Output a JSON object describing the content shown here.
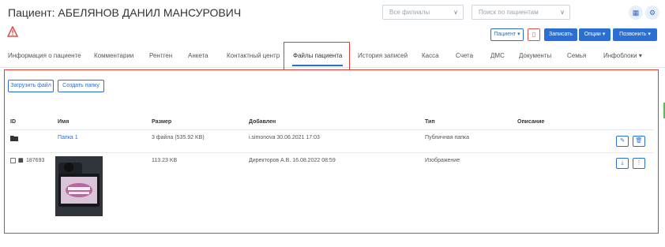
{
  "header": {
    "title": "Пациент: АБЕЛЯНОВ ДАНИЛ МАНСУРОВИЧ",
    "branches_placeholder": "Все филиалы",
    "search_placeholder": "Поиск по пациентам"
  },
  "toolbar": {
    "patient": "Пациент ▾",
    "book": "Записать",
    "options": "Опции ▾",
    "call": "Позвонить ▾"
  },
  "tabs": [
    "Информация о пациенте",
    "Комментарии",
    "Рентген",
    "Анкета",
    "Контактный центр",
    "Файлы пациента",
    "История записей",
    "Касса",
    "Счета",
    "ДМС",
    "Документы",
    "Семья",
    "Инфоблоки ▾"
  ],
  "files": {
    "upload_label": "Загрузить файл",
    "create_folder_label": "Создать папку",
    "columns": [
      "ID",
      "Имя",
      "Размер",
      "Добавлен",
      "Тип",
      "Описание"
    ],
    "rows": [
      {
        "id": "",
        "name": "Папка 1",
        "size": "3 файла (535.92 KB)",
        "added": "i.simonova 30.06.2021 17:03",
        "type": "Публичная папка",
        "description": ""
      },
      {
        "id": "187693",
        "name": "",
        "size": "113.23 KB",
        "added": "Директоров А.В. 16.08.2022 08:59",
        "type": "Изображение",
        "description": ""
      }
    ]
  },
  "colors": {
    "accent": "#2a6fd4",
    "highlight": "#e53935",
    "warning": "#d9534f"
  }
}
